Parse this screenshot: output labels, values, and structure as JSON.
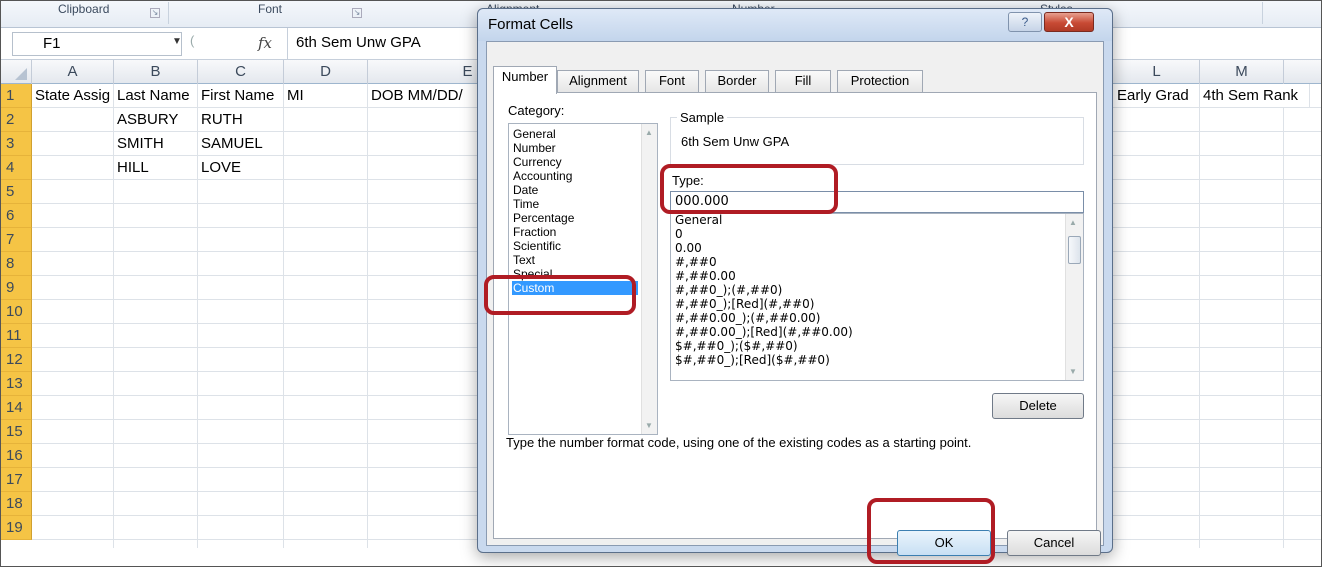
{
  "ribbon": {
    "groups": [
      "Clipboard",
      "Font",
      "Alignment",
      "Number",
      "Styles"
    ]
  },
  "formula_bar": {
    "name_box": "F1",
    "fx_label": "fx",
    "value": "6th Sem Unw GPA"
  },
  "sheet": {
    "columns": [
      "A",
      "B",
      "C",
      "D",
      "E",
      "L",
      "M"
    ],
    "rows": [
      "1",
      "2",
      "3",
      "4",
      "5",
      "6",
      "7",
      "8",
      "9",
      "10",
      "11",
      "12",
      "13",
      "14",
      "15",
      "16",
      "17",
      "18",
      "19"
    ],
    "header_row": {
      "A": "State Assig",
      "B": "Last Name",
      "C": "First Name",
      "D": "MI",
      "E": "DOB MM/DD/",
      "L": "Early Grad",
      "M": "4th Sem Rank"
    },
    "data": [
      {
        "last": "ASBURY",
        "first": "RUTH"
      },
      {
        "last": "SMITH",
        "first": "SAMUEL"
      },
      {
        "last": "HILL",
        "first": "LOVE"
      }
    ]
  },
  "dialog": {
    "title": "Format Cells",
    "help_label": "?",
    "close_label": "X",
    "tabs": [
      "Number",
      "Alignment",
      "Font",
      "Border",
      "Fill",
      "Protection"
    ],
    "active_tab": "Number",
    "category_label": "Category:",
    "categories": [
      "General",
      "Number",
      "Currency",
      "Accounting",
      "Date",
      "Time",
      "Percentage",
      "Fraction",
      "Scientific",
      "Text",
      "Special",
      "Custom"
    ],
    "selected_category": "Custom",
    "sample_label": "Sample",
    "sample_value": "6th Sem Unw GPA",
    "type_label": "Type:",
    "type_value": "000.000",
    "formats": [
      "General",
      "0",
      "0.00",
      "#,##0",
      "#,##0.00",
      "#,##0_);(#,##0)",
      "#,##0_);[Red](#,##0)",
      "#,##0.00_);(#,##0.00)",
      "#,##0.00_);[Red](#,##0.00)",
      "$#,##0_);($#,##0)",
      "$#,##0_);[Red]($#,##0)"
    ],
    "delete_label": "Delete",
    "hint": "Type the number format code, using one of the existing codes as a starting point.",
    "ok_label": "OK",
    "cancel_label": "Cancel"
  },
  "colors": {
    "highlight": "#b01c24",
    "row_header": "#f5c445",
    "selection": "#3399ff"
  }
}
